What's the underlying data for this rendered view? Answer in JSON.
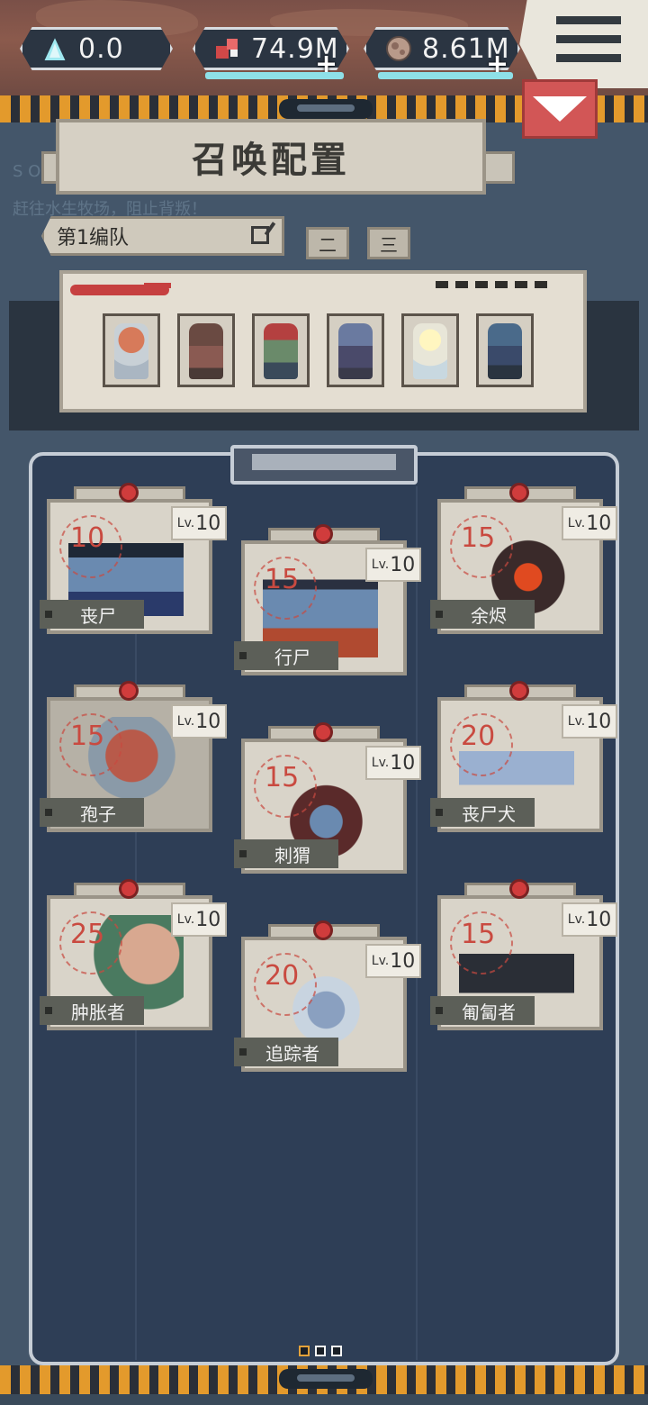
{
  "resources": {
    "crystal": "0.0",
    "flesh": "74.9M",
    "bone": "8.61M"
  },
  "background_text": {
    "line1": "S O",
    "line2": "赶往水生牧场，阻止背叛！"
  },
  "title": "召唤配置",
  "team": {
    "current": "第1编队",
    "tab2": "二",
    "tab3": "三"
  },
  "squad_slots": [
    {
      "icon": "spore-character"
    },
    {
      "icon": "brute-character"
    },
    {
      "icon": "axe-warrior-character"
    },
    {
      "icon": "demon-character"
    },
    {
      "icon": "glowing-ghost-character"
    },
    {
      "icon": "masked-zombie-character"
    }
  ],
  "minions": [
    {
      "name": "丧尸",
      "cost": "10",
      "level_prefix": "Lv.",
      "level": "10"
    },
    {
      "name": "行尸",
      "cost": "15",
      "level_prefix": "Lv.",
      "level": "10"
    },
    {
      "name": "余烬",
      "cost": "15",
      "level_prefix": "Lv.",
      "level": "10"
    },
    {
      "name": "孢子",
      "cost": "15",
      "level_prefix": "Lv.",
      "level": "10"
    },
    {
      "name": "刺猬",
      "cost": "15",
      "level_prefix": "Lv.",
      "level": "10"
    },
    {
      "name": "丧尸犬",
      "cost": "20",
      "level_prefix": "Lv.",
      "level": "10"
    },
    {
      "name": "肿胀者",
      "cost": "25",
      "level_prefix": "Lv.",
      "level": "10"
    },
    {
      "name": "追踪者",
      "cost": "20",
      "level_prefix": "Lv.",
      "level": "10"
    },
    {
      "name": "匍匐者",
      "cost": "15",
      "level_prefix": "Lv.",
      "level": "10"
    }
  ],
  "colors": {
    "hazard_orange": "#e39a2c",
    "panel_navy": "#2e3e56",
    "cost_red": "#c94a40",
    "collapse_red": "#d25656"
  }
}
